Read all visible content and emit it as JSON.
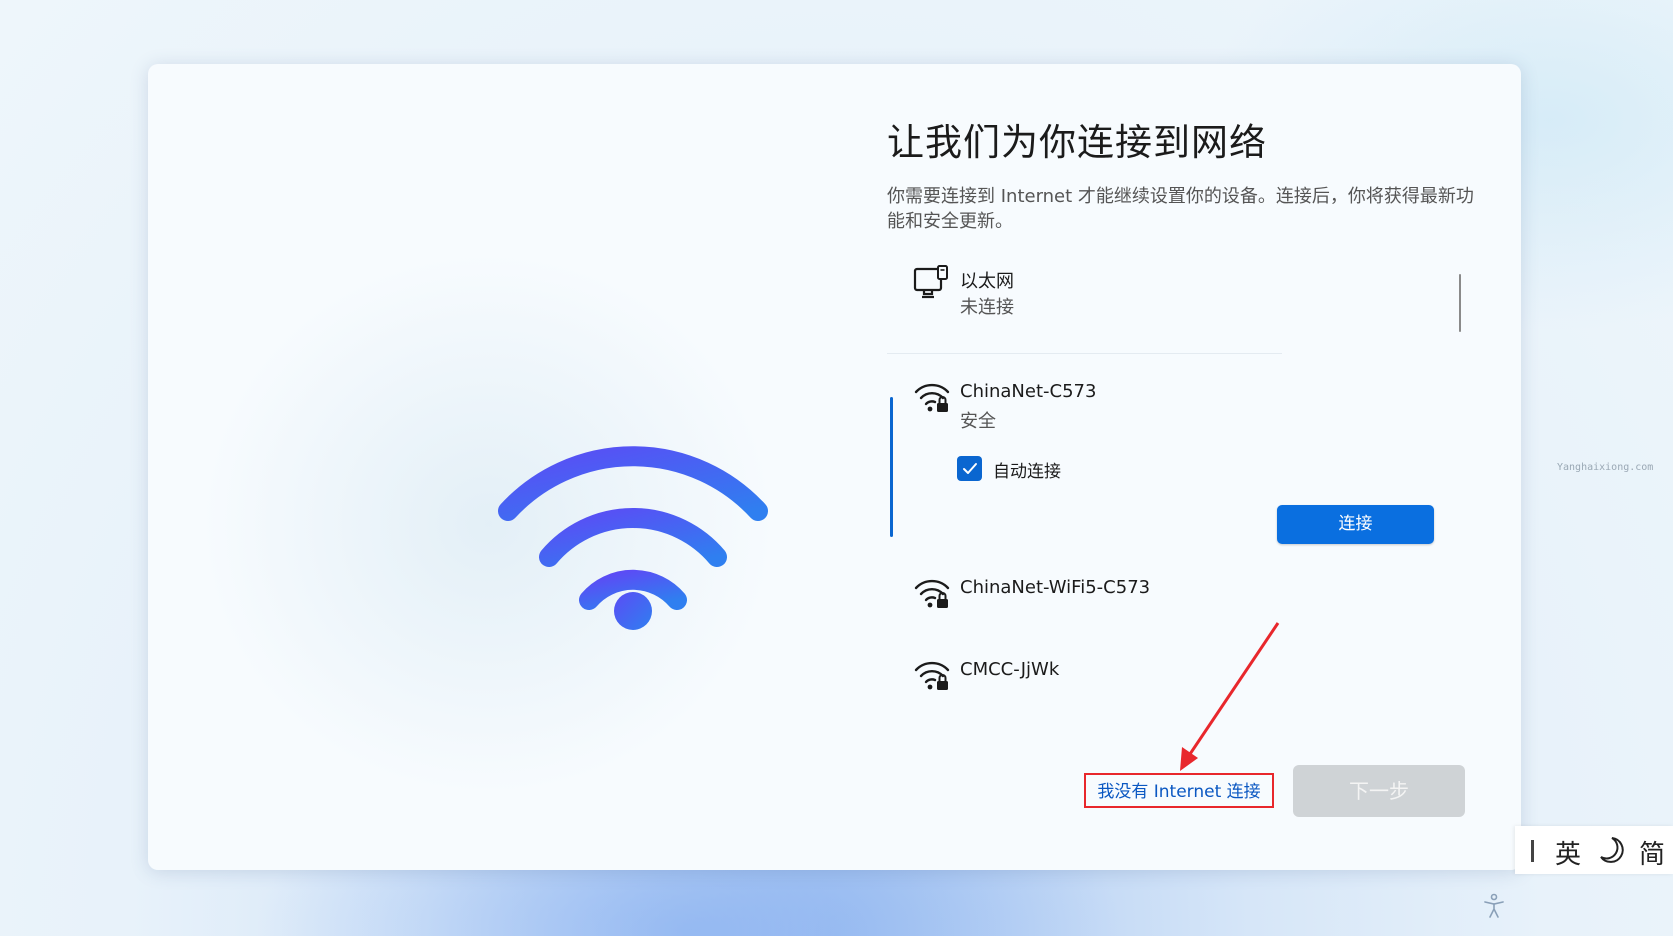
{
  "page": {
    "title": "让我们为你连接到网络",
    "description": "你需要连接到 Internet 才能继续设置你的设备。连接后，你将获得最新功能和安全更新。"
  },
  "networks": [
    {
      "name": "以太网",
      "status": "未连接",
      "icon": "ethernet-icon"
    },
    {
      "name": "ChinaNet-C573",
      "status": "安全",
      "icon": "wifi-secure-icon",
      "selected": true
    },
    {
      "name": "ChinaNet-WiFi5-C573",
      "status": "",
      "icon": "wifi-secure-icon"
    },
    {
      "name": "CMCC-JjWk",
      "status": "",
      "icon": "wifi-secure-icon"
    }
  ],
  "auto_connect": {
    "label": "自动连接",
    "checked": true
  },
  "buttons": {
    "connect": "连接",
    "no_internet": "我没有 Internet 连接",
    "next": "下一步"
  },
  "watermark": "Yanghaixiong.com",
  "ime": {
    "lang": "英",
    "mode": "简"
  },
  "colors": {
    "accent": "#0a66d0",
    "highlight_box": "#e8272c",
    "wifi_gradient_start": "#5b4cf5",
    "wifi_gradient_end": "#2f7ff0"
  }
}
